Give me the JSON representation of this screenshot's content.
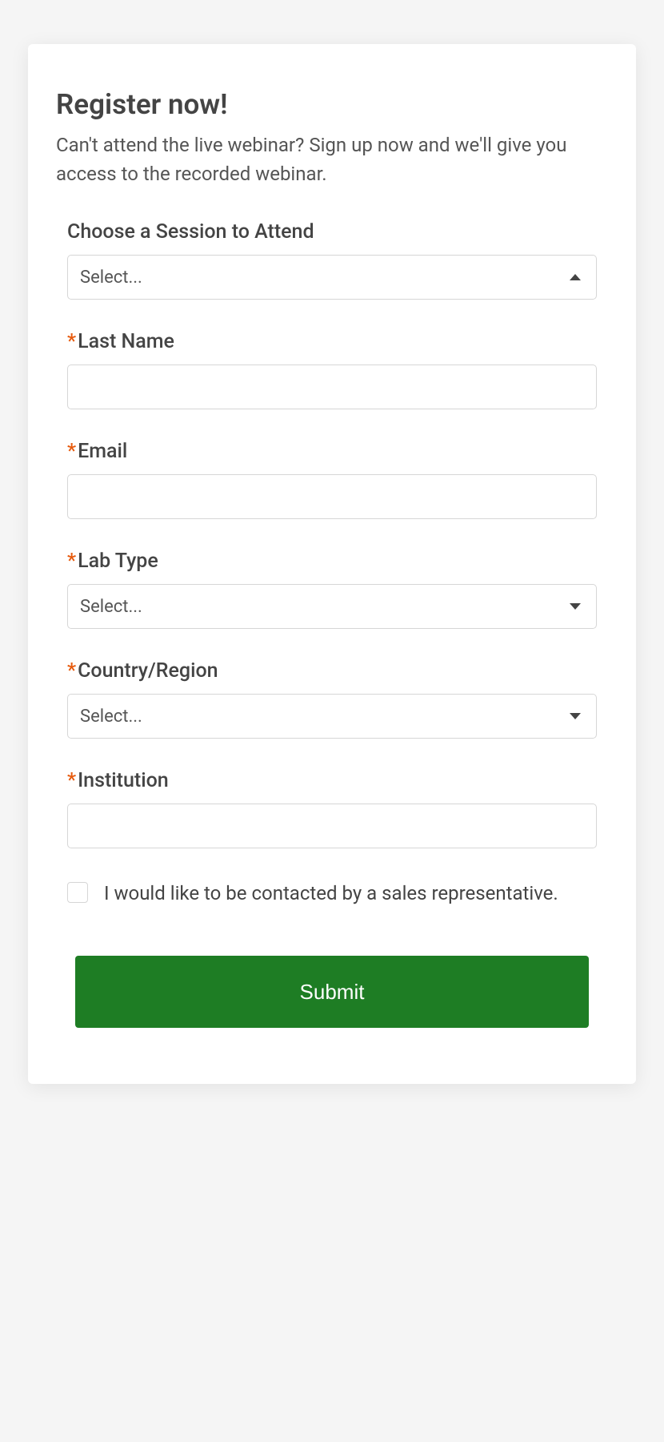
{
  "heading": "Register now!",
  "subheading": "Can't attend the live webinar? Sign up now and we'll give you access to the recorded webinar.",
  "form": {
    "session": {
      "label": "Choose a Session to Attend",
      "placeholder": "Select..."
    },
    "lastName": {
      "label": "Last Name",
      "value": ""
    },
    "email": {
      "label": "Email",
      "value": ""
    },
    "labType": {
      "label": "Lab Type",
      "placeholder": "Select..."
    },
    "country": {
      "label": "Country/Region",
      "placeholder": "Select..."
    },
    "institution": {
      "label": "Institution",
      "value": ""
    },
    "contactSales": {
      "label": "I would like to be contacted by a sales representative."
    },
    "submitLabel": "Submit",
    "requiredMark": "*"
  }
}
